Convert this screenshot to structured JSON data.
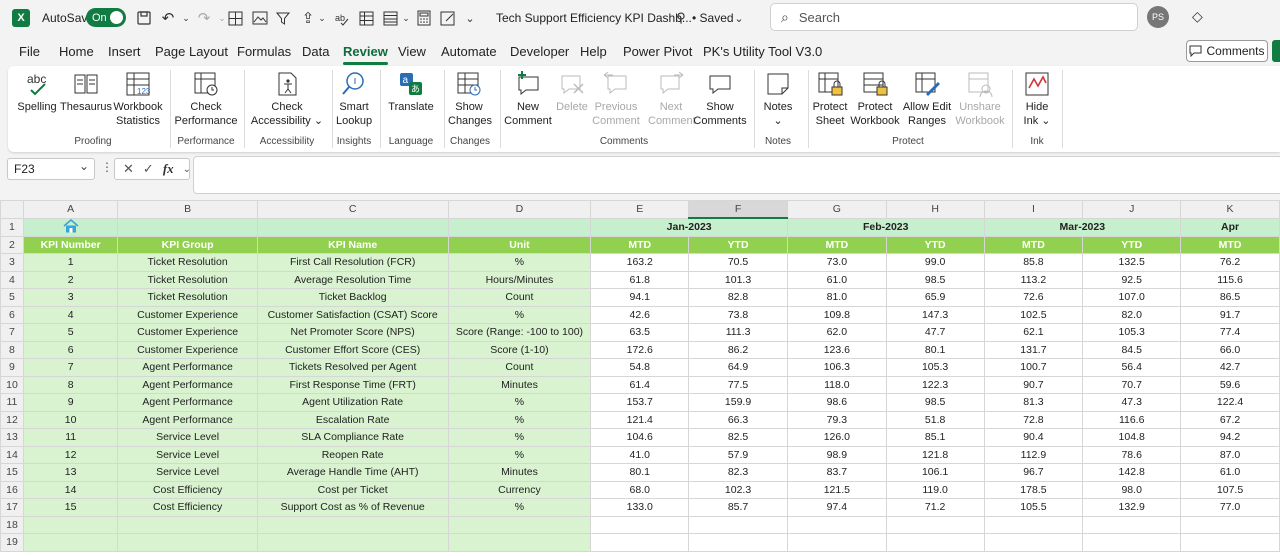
{
  "titlebar": {
    "app_icon": "X",
    "autosave_label": "AutoSave",
    "autosave_state": "On",
    "doc_title": "Tech Support Efficiency KPI Dashb...",
    "saved_label": "• Saved",
    "search_placeholder": "Search",
    "avatar_initials": "PS"
  },
  "menu": {
    "items": [
      "File",
      "Home",
      "Insert",
      "Page Layout",
      "Formulas",
      "Data",
      "Review",
      "View",
      "Automate",
      "Developer",
      "Help",
      "Power Pivot",
      "PK's Utility Tool V3.0"
    ],
    "active": "Review",
    "comments_label": "Comments"
  },
  "ribbon": {
    "groups": [
      {
        "label": "Proofing",
        "buttons": [
          "Spelling",
          "Thesaurus",
          "Workbook Statistics"
        ]
      },
      {
        "label": "Performance",
        "buttons": [
          "Check Performance"
        ]
      },
      {
        "label": "Accessibility",
        "buttons": [
          "Check Accessibility ⌄"
        ]
      },
      {
        "label": "Insights",
        "buttons": [
          "Smart Lookup"
        ]
      },
      {
        "label": "Language",
        "buttons": [
          "Translate"
        ]
      },
      {
        "label": "Changes",
        "buttons": [
          "Show Changes"
        ]
      },
      {
        "label": "Comments",
        "buttons": [
          "New Comment",
          "Delete",
          "Previous Comment",
          "Next Comment",
          "Show Comments"
        ]
      },
      {
        "label": "Notes",
        "buttons": [
          "Notes ⌄"
        ]
      },
      {
        "label": "Protect",
        "buttons": [
          "Protect Sheet",
          "Protect Workbook",
          "Allow Edit Ranges",
          "Unshare Workbook"
        ]
      },
      {
        "label": "Ink",
        "buttons": [
          "Hide Ink ⌄"
        ]
      }
    ]
  },
  "formula_bar": {
    "name_box": "F23",
    "formula": ""
  },
  "sheet": {
    "col_letters": [
      "A",
      "B",
      "C",
      "D",
      "E",
      "F",
      "G",
      "H",
      "I",
      "J",
      "K"
    ],
    "selected_col": "F",
    "months": [
      "Jan-2023",
      "Feb-2023",
      "Mar-2023",
      "Apr"
    ],
    "headers": [
      "KPI Number",
      "KPI Group",
      "KPI Name",
      "Unit",
      "MTD",
      "YTD",
      "MTD",
      "YTD",
      "MTD",
      "YTD",
      "MTD"
    ],
    "rows": [
      [
        "1",
        "Ticket Resolution",
        "First Call Resolution (FCR)",
        "%",
        "163.2",
        "70.5",
        "73.0",
        "99.0",
        "85.8",
        "132.5",
        "76.2"
      ],
      [
        "2",
        "Ticket Resolution",
        "Average Resolution Time",
        "Hours/Minutes",
        "61.8",
        "101.3",
        "61.0",
        "98.5",
        "113.2",
        "92.5",
        "115.6"
      ],
      [
        "3",
        "Ticket Resolution",
        "Ticket Backlog",
        "Count",
        "94.1",
        "82.8",
        "81.0",
        "65.9",
        "72.6",
        "107.0",
        "86.5"
      ],
      [
        "4",
        "Customer Experience",
        "Customer Satisfaction (CSAT) Score",
        "%",
        "42.6",
        "73.8",
        "109.8",
        "147.3",
        "102.5",
        "82.0",
        "91.7"
      ],
      [
        "5",
        "Customer Experience",
        "Net Promoter Score (NPS)",
        "Score (Range: -100 to 100)",
        "63.5",
        "111.3",
        "62.0",
        "47.7",
        "62.1",
        "105.3",
        "77.4"
      ],
      [
        "6",
        "Customer Experience",
        "Customer Effort Score (CES)",
        "Score (1-10)",
        "172.6",
        "86.2",
        "123.6",
        "80.1",
        "131.7",
        "84.5",
        "66.0"
      ],
      [
        "7",
        "Agent Performance",
        "Tickets Resolved per Agent",
        "Count",
        "54.8",
        "64.9",
        "106.3",
        "105.3",
        "100.7",
        "56.4",
        "42.7"
      ],
      [
        "8",
        "Agent Performance",
        "First Response Time (FRT)",
        "Minutes",
        "61.4",
        "77.5",
        "118.0",
        "122.3",
        "90.7",
        "70.7",
        "59.6"
      ],
      [
        "9",
        "Agent Performance",
        "Agent Utilization Rate",
        "%",
        "153.7",
        "159.9",
        "98.6",
        "98.5",
        "81.3",
        "47.3",
        "122.4"
      ],
      [
        "10",
        "Agent Performance",
        "Escalation Rate",
        "%",
        "121.4",
        "66.3",
        "79.3",
        "51.8",
        "72.8",
        "116.6",
        "67.2"
      ],
      [
        "11",
        "Service Level",
        "SLA Compliance Rate",
        "%",
        "104.6",
        "82.5",
        "126.0",
        "85.1",
        "90.4",
        "104.8",
        "94.2"
      ],
      [
        "12",
        "Service Level",
        "Reopen Rate",
        "%",
        "41.0",
        "57.9",
        "98.9",
        "121.8",
        "112.9",
        "78.6",
        "87.0"
      ],
      [
        "13",
        "Service Level",
        "Average Handle Time (AHT)",
        "Minutes",
        "80.1",
        "82.3",
        "83.7",
        "106.1",
        "96.7",
        "142.8",
        "61.0"
      ],
      [
        "14",
        "Cost Efficiency",
        "Cost per Ticket",
        "Currency",
        "68.0",
        "102.3",
        "121.5",
        "119.0",
        "178.5",
        "98.0",
        "107.5"
      ],
      [
        "15",
        "Cost Efficiency",
        "Support Cost as % of Revenue",
        "%",
        "133.0",
        "85.7",
        "97.4",
        "71.2",
        "105.5",
        "132.9",
        "77.0"
      ]
    ],
    "row_numbers": [
      "1",
      "2",
      "3",
      "4",
      "5",
      "6",
      "7",
      "8",
      "9",
      "10",
      "11",
      "12",
      "13",
      "14",
      "15",
      "16",
      "17",
      "18",
      "19"
    ],
    "colors": {
      "header_green": "#92d050",
      "light_green": "#c6efce",
      "key_col_green": "#d9f2d0"
    }
  }
}
